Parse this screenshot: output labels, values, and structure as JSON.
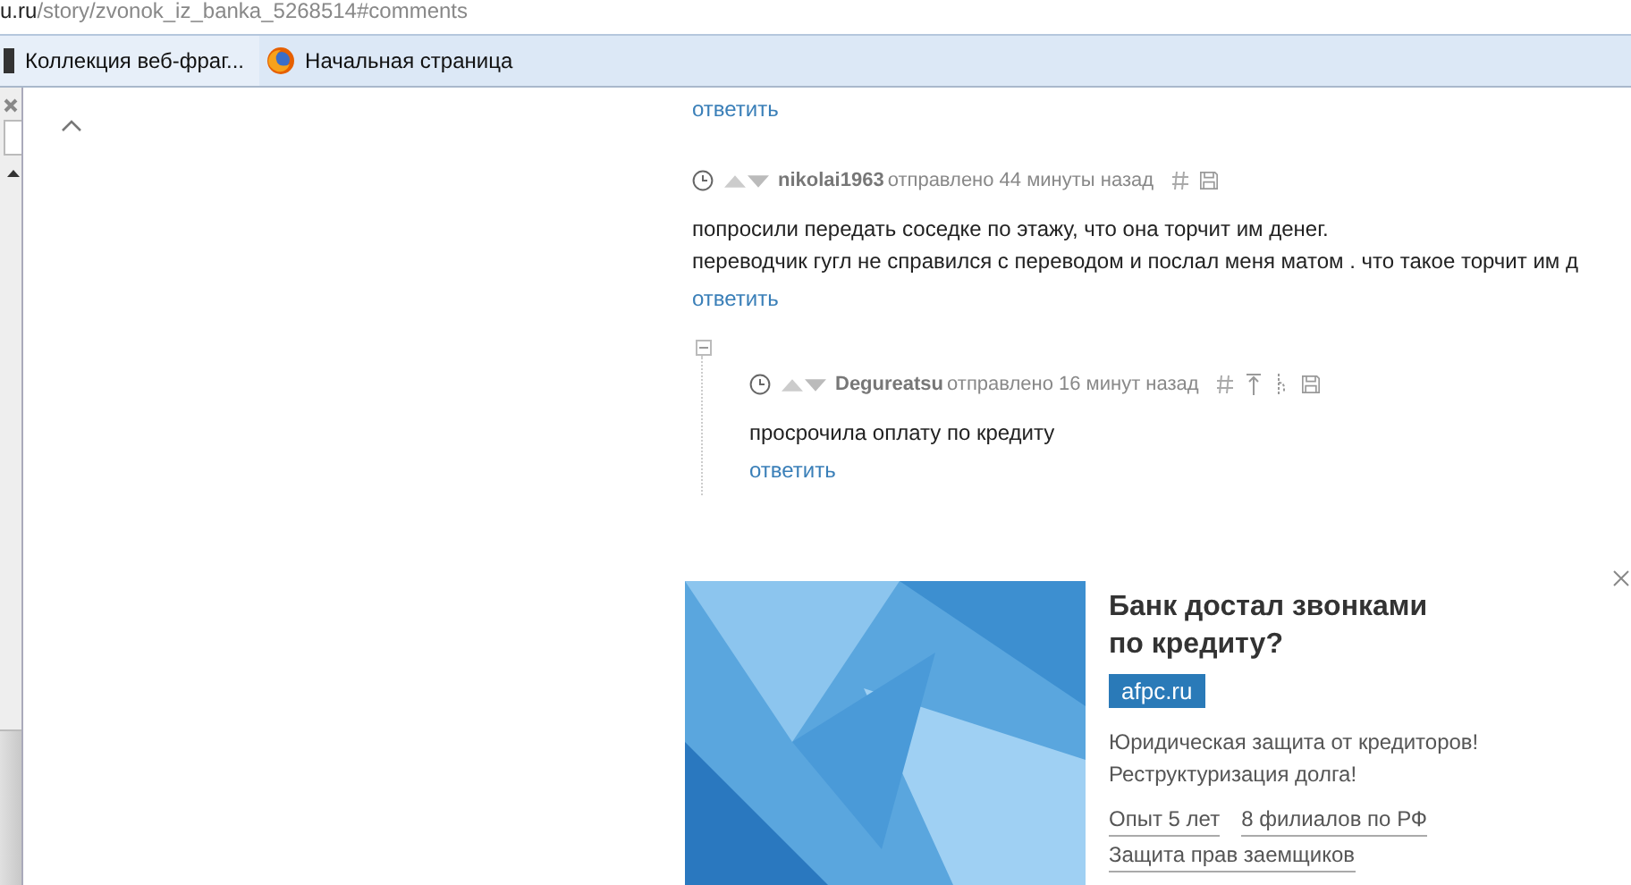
{
  "address_bar": {
    "domain": "u.ru",
    "path": "/story/zvonok_iz_banka_5268514#comments"
  },
  "bookmarks": [
    {
      "label": "Коллекция веб-фраг...",
      "kind": "page"
    },
    {
      "label": "Начальная страница",
      "kind": "firefox"
    }
  ],
  "top_reply": "ответить",
  "comments": [
    {
      "author": "nikolai1963",
      "meta": "отправлено 44 минуты назад",
      "kind": "top",
      "lines": [
        "попросили передать соседке по этажу, что она торчит им денег.",
        "переводчик гугл не справился с переводом и послал меня матом . что такое торчит им д"
      ],
      "reply": "ответить",
      "children": [
        {
          "author": "Degureatsu",
          "meta": "отправлено 16 минут назад",
          "kind": "reply",
          "lines": [
            "просрочила оплату по кредиту"
          ],
          "reply": "ответить"
        }
      ]
    }
  ],
  "ad": {
    "title_lines": [
      "Банк достал звонками",
      "по кредиту?"
    ],
    "domain": "afpc.ru",
    "text_lines": [
      "Юридическая защита от кредиторов!",
      "Реструктуризация долга!"
    ],
    "links": [
      "Опыт 5 лет",
      "8 филиалов по РФ",
      "Защита прав заемщиков"
    ]
  }
}
